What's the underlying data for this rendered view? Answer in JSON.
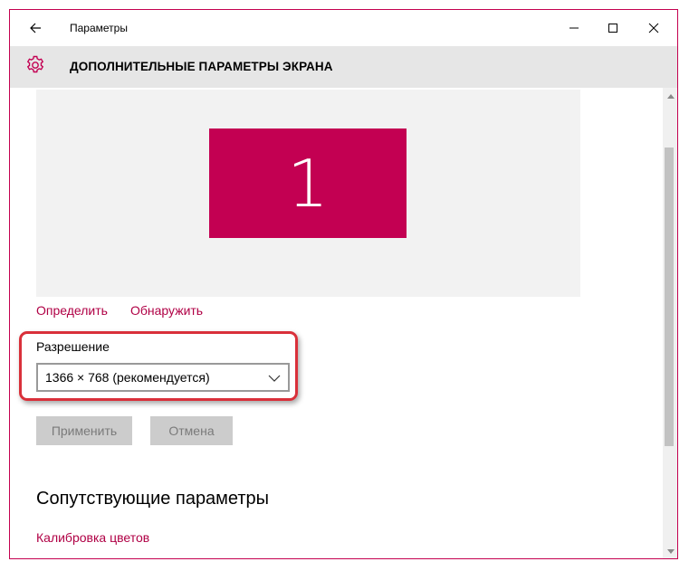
{
  "titlebar": {
    "back_icon": "arrow-left-icon",
    "title": "Параметры",
    "controls": [
      "minimize-icon",
      "maximize-icon",
      "close-icon"
    ]
  },
  "header": {
    "icon": "gear-icon",
    "title": "ДОПОЛНИТЕЛЬНЫЕ ПАРАМЕТРЫ ЭКРАНА"
  },
  "display": {
    "monitor_number": "1",
    "identify_link": "Определить",
    "detect_link": "Обнаружить"
  },
  "resolution": {
    "label": "Разрешение",
    "selected": "1366 × 768 (рекомендуется)"
  },
  "buttons": {
    "apply": "Применить",
    "cancel": "Отмена"
  },
  "related": {
    "title": "Сопутствующие параметры",
    "calibration_link": "Калибровка цветов"
  },
  "colors": {
    "accent": "#c30052",
    "link": "#b00045",
    "highlight": "#d9303a",
    "header_bg": "#e6e6e6"
  }
}
